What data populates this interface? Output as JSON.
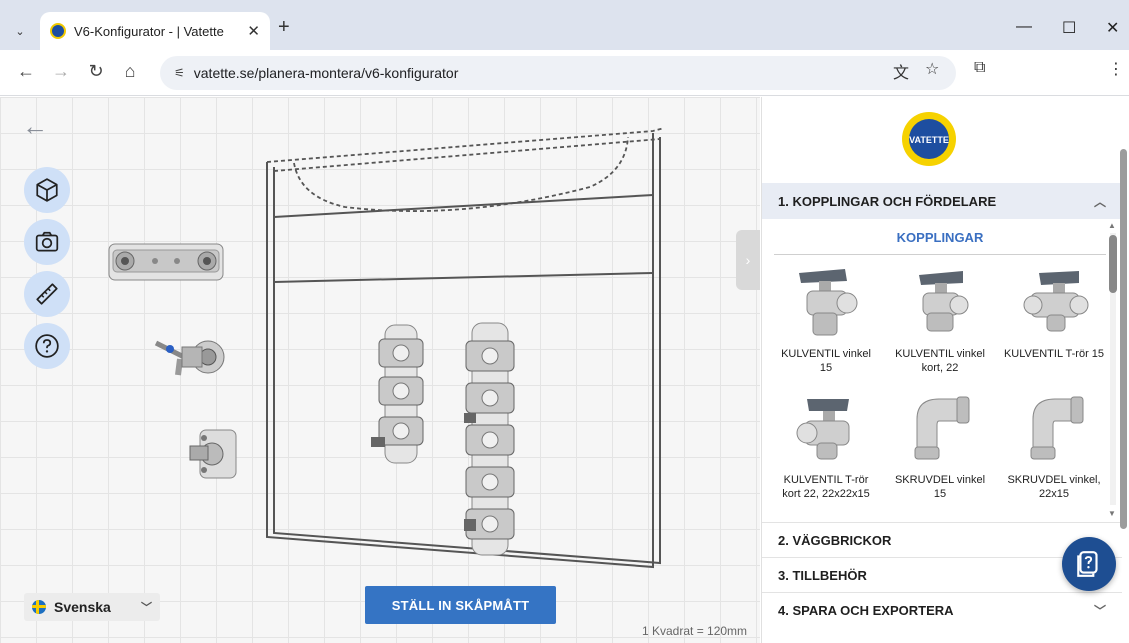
{
  "browser": {
    "tab_title": "V6-Konfigurator - | Vatette",
    "url": "vatette.se/planera-montera/v6-konfigurator",
    "new_tab_label": "+"
  },
  "workspace": {
    "language_label": "Svenska",
    "cta_label": "STÄLL IN SKÅPMÅTT",
    "scale_note": "1 Kvadrat = 120mm"
  },
  "panel": {
    "logo_text": "VATETTE",
    "sections": [
      {
        "label": "1. KOPPLINGAR OCH FÖRDELARE",
        "expanded": true
      },
      {
        "label": "2. VÄGGBRICKOR",
        "expanded": false
      },
      {
        "label": "3. TILLBEHÖR",
        "expanded": false
      },
      {
        "label": "4. SPARA OCH EXPORTERA",
        "expanded": false
      }
    ],
    "subheading": "KOPPLINGAR",
    "products": [
      {
        "label": "KULVENTIL vinkel 15"
      },
      {
        "label": "KULVENTIL vinkel kort, 22"
      },
      {
        "label": "KULVENTIL T-rör 15"
      },
      {
        "label": "KULVENTIL T-rör kort 22, 22x22x15"
      },
      {
        "label": "SKRUVDEL vinkel 15"
      },
      {
        "label": "SKRUVDEL vinkel, 22x15"
      }
    ]
  },
  "colors": {
    "accent": "#3574c4",
    "tool_button_bg": "#cfe0f7",
    "panel_header_bg": "#e8ecf4",
    "help_fab": "#1e4e92"
  }
}
